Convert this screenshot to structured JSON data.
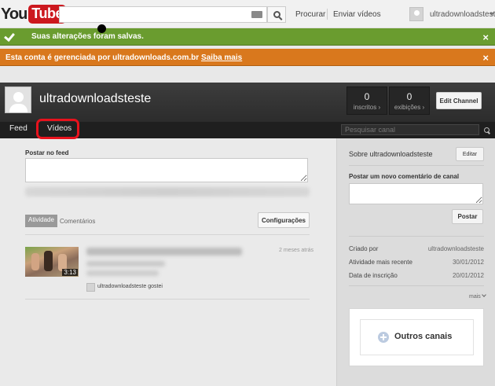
{
  "masthead": {
    "logo_you": "You",
    "logo_tube": "Tube",
    "search_placeholder": "",
    "links": {
      "browse": "Procurar",
      "upload": "Enviar vídeos"
    },
    "username": "ultradownloadsteste"
  },
  "alerts": {
    "saved": {
      "text": "Suas alterações foram salvas.",
      "close": "×",
      "color": "#6a9c2f"
    },
    "managed": {
      "text": "Esta conta é gerenciada por ultradownloads.com.br",
      "link": "Saiba mais",
      "close": "×",
      "color": "#d9781d"
    }
  },
  "channel": {
    "name": "ultradownloadsteste",
    "stats": [
      {
        "value": "0",
        "label": "inscritos ›"
      },
      {
        "value": "0",
        "label": "exibições ›"
      }
    ],
    "edit_button": "Edit Channel",
    "tabs": [
      {
        "label": "Feed"
      },
      {
        "label": "Vídeos"
      }
    ],
    "search_placeholder": "Pesquisar canal",
    "highlight_color": "#e8121d"
  },
  "feed": {
    "post_label": "Postar no feed",
    "tabs": [
      {
        "label": "Atividade",
        "active": true
      },
      {
        "label": "Comentários",
        "active": false
      }
    ],
    "settings_button": "Configurações",
    "items": [
      {
        "duration": "3:13",
        "time": "2 meses atrás",
        "liker": "ultradownloadsteste gostei"
      }
    ]
  },
  "sidebar": {
    "about_title": "Sobre ultradownloadsteste",
    "edit_button": "Editar",
    "comment_label": "Postar um novo comentário de canal",
    "post_button": "Postar",
    "info": [
      {
        "label": "Criado por",
        "value": "ultradownloadsteste"
      },
      {
        "label": "Atividade mais recente",
        "value": "30/01/2012"
      },
      {
        "label": "Data de inscrição",
        "value": "20/01/2012"
      }
    ],
    "more": "mais",
    "other_channels": "Outros canais"
  }
}
